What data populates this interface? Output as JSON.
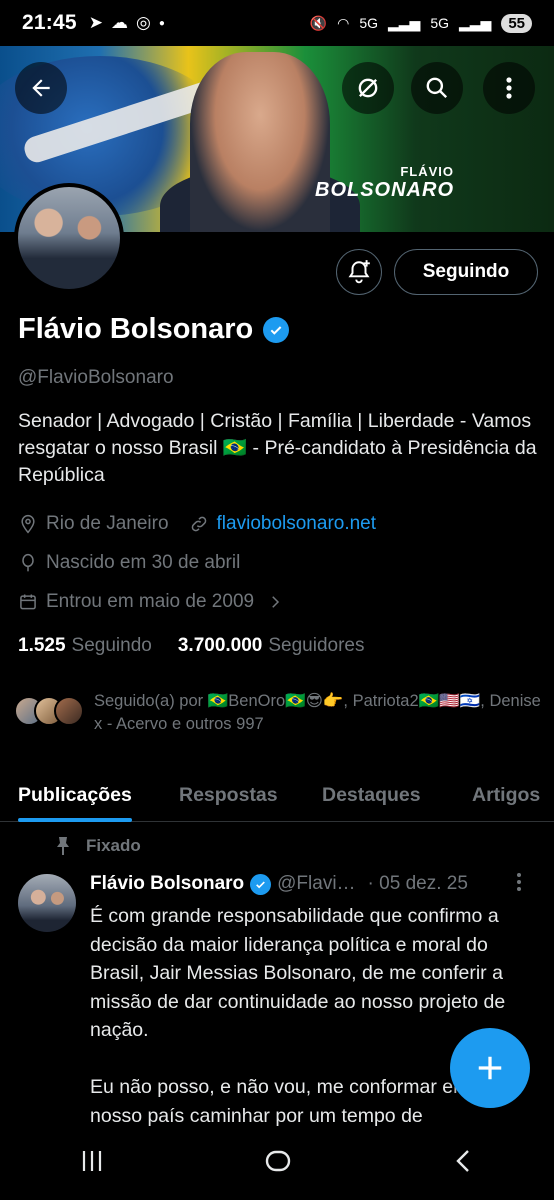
{
  "status_bar": {
    "time": "21:45",
    "battery": "55",
    "network1": "5G",
    "network2": "5G"
  },
  "banner": {
    "brand_line1": "FLÁVIO",
    "brand_line2": "BOLSONARO"
  },
  "profile": {
    "name": "Flávio Bolsonaro",
    "handle": "@FlavioBolsonaro",
    "bio": "Senador | Advogado | Cristão | Família | Liberdade  - Vamos resgatar o nosso Brasil 🇧🇷 - Pré-candidato à Presidência da República",
    "location": "Rio de Janeiro",
    "website": "flaviobolsonaro.net",
    "birthday": "Nascido em 30 de abril",
    "joined": "Entrou em maio de 2009",
    "following_count": "1.525",
    "following_label": "Seguindo",
    "followers_count": "3.700.000",
    "followers_label": "Seguidores",
    "followed_by": "Seguido(a) por 🇧🇷BenOro🇧🇷😎👉, Patriota2🇧🇷🇺🇸🇮🇱, Denise x - Acervo e outros 997"
  },
  "buttons": {
    "following": "Seguindo"
  },
  "tabs": [
    {
      "label": "Publicações",
      "active": true
    },
    {
      "label": "Respostas",
      "active": false
    },
    {
      "label": "Destaques",
      "active": false
    },
    {
      "label": "Artigos",
      "active": false
    }
  ],
  "post": {
    "pinned_label": "Fixado",
    "author": "Flávio Bolsonaro",
    "handle": "@Flavi…",
    "date": "· 05 dez. 25",
    "text": "É com grande responsabilidade que confirmo a decisão da maior liderança política e moral do Brasil, Jair Messias Bolsonaro, de me conferir a missão de dar continuidade ao nosso projeto de nação.\n\nEu não posso, e não vou, me conformar em ver o nosso país caminhar por um tempo de"
  },
  "colors": {
    "accent": "#1d9bf0",
    "muted": "#71767b",
    "background": "#000000"
  }
}
